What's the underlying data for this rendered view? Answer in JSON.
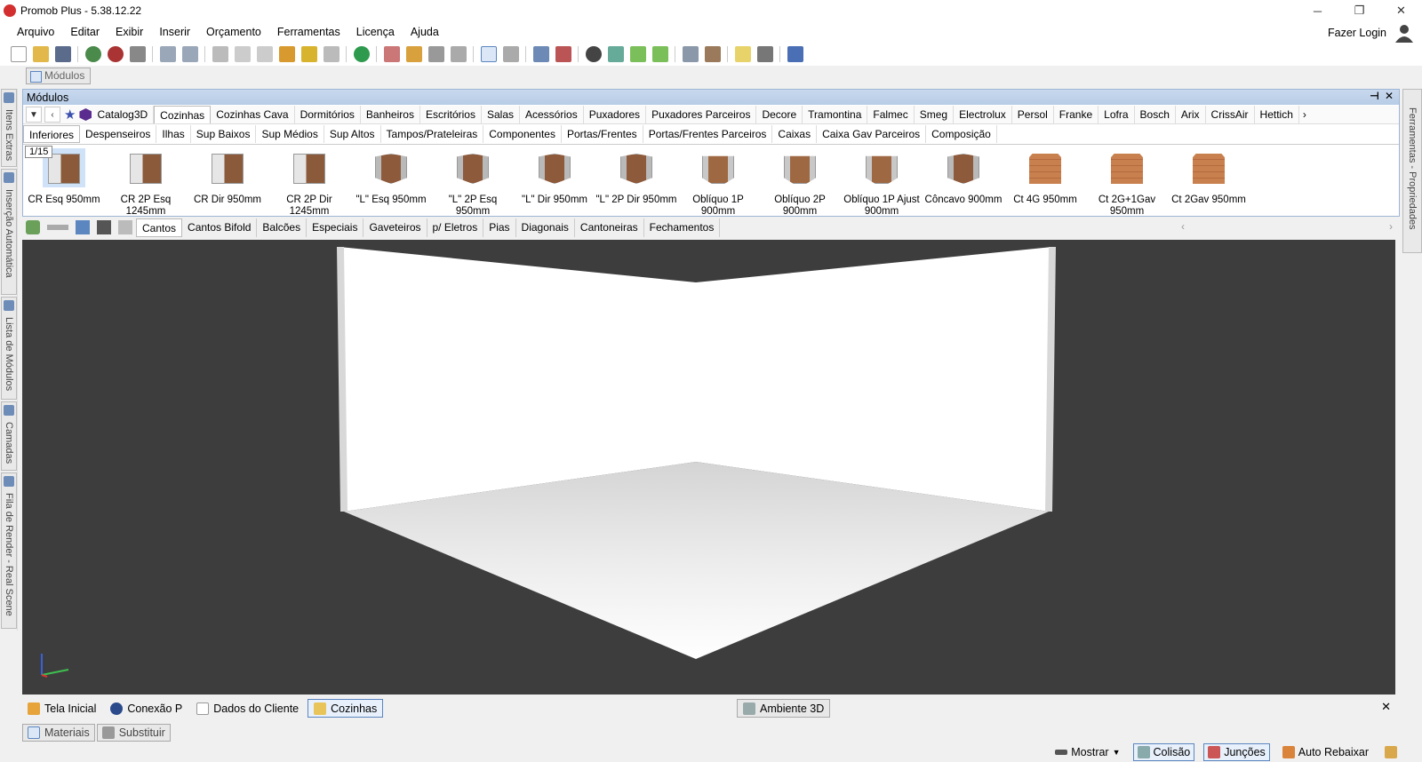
{
  "window": {
    "title": "Promob Plus - 5.38.12.22",
    "controls": [
      "─",
      "❐",
      "✕"
    ]
  },
  "menu": [
    "Arquivo",
    "Editar",
    "Exibir",
    "Inserir",
    "Orçamento",
    "Ferramentas",
    "Licença",
    "Ajuda"
  ],
  "login_label": "Fazer Login",
  "modulos_tab_label": "Módulos",
  "side_tabs_left": [
    "Itens Extras",
    "Inserção Automática",
    "Lista de Módulos",
    "Camadas",
    "Fila de Render - Real Scene"
  ],
  "side_tab_right": "Ferramentas - Propriedades",
  "panel": {
    "title": "Módulos",
    "catalog_label": "Catalog3D",
    "category_tabs": [
      "Cozinhas",
      "Cozinhas Cava",
      "Dormitórios",
      "Banheiros",
      "Escritórios",
      "Salas",
      "Acessórios",
      "Puxadores",
      "Puxadores Parceiros",
      "Decore",
      "Tramontina",
      "Falmec",
      "Smeg",
      "Electrolux",
      "Persol",
      "Franke",
      "Lofra",
      "Bosch",
      "Arix",
      "CrissAir",
      "Hettich"
    ],
    "active_category": "Cozinhas",
    "sub_tabs": [
      "Inferiores",
      "Despenseiros",
      "Ilhas",
      "Sup Baixos",
      "Sup Médios",
      "Sup Altos",
      "Tampos/Prateleiras",
      "Componentes",
      "Portas/Frentes",
      "Portas/Frentes Parceiros",
      "Caixas",
      "Caixa Gav Parceiros",
      "Composição"
    ],
    "active_sub_tab": "Inferiores",
    "page_indicator": "1/15",
    "thumbnails": [
      {
        "label": "CR Esq 950mm",
        "style": "box"
      },
      {
        "label": "CR 2P Esq 1245mm",
        "style": "box"
      },
      {
        "label": "CR Dir 950mm",
        "style": "box"
      },
      {
        "label": "CR 2P Dir 1245mm",
        "style": "box"
      },
      {
        "label": "\"L\" Esq 950mm",
        "style": "corner"
      },
      {
        "label": "\"L\" 2P Esq 950mm",
        "style": "corner"
      },
      {
        "label": "\"L\" Dir 950mm",
        "style": "corner"
      },
      {
        "label": "\"L\" 2P Dir 950mm",
        "style": "corner"
      },
      {
        "label": "Oblíquo 1P 900mm",
        "style": "oblique"
      },
      {
        "label": "Oblíquo 2P 900mm",
        "style": "oblique"
      },
      {
        "label": "Oblíquo 1P Ajust 900mm",
        "style": "oblique"
      },
      {
        "label": "Côncavo 900mm",
        "style": "corner"
      },
      {
        "label": "Ct 4G 950mm",
        "style": "tall"
      },
      {
        "label": "Ct 2G+1Gav 950mm",
        "style": "tall"
      },
      {
        "label": "Ct 2Gav 950mm",
        "style": "tall"
      }
    ]
  },
  "filter_tabs": [
    "Cantos",
    "Cantos Bifold",
    "Balcões",
    "Especiais",
    "Gaveteiros",
    "p/ Eletros",
    "Pias",
    "Diagonais",
    "Cantoneiras",
    "Fechamentos"
  ],
  "active_filter": "Cantos",
  "document_tabs": [
    "Tela Inicial",
    "Conexão P",
    "Dados do Cliente",
    "Cozinhas"
  ],
  "active_document": "Cozinhas",
  "ambiente_tab": "Ambiente 3D",
  "bottom_tabs": [
    "Materiais",
    "Substituir"
  ],
  "status": {
    "mostrar": "Mostrar",
    "colisao": "Colisão",
    "juncoes": "Junções",
    "auto_rebaixar": "Auto Rebaixar"
  },
  "colors": {
    "accent": "#5b86c0",
    "panel_header": "#c2d4ec",
    "viewport_bg": "#3d3d3d",
    "brand": "#d32f2f"
  }
}
